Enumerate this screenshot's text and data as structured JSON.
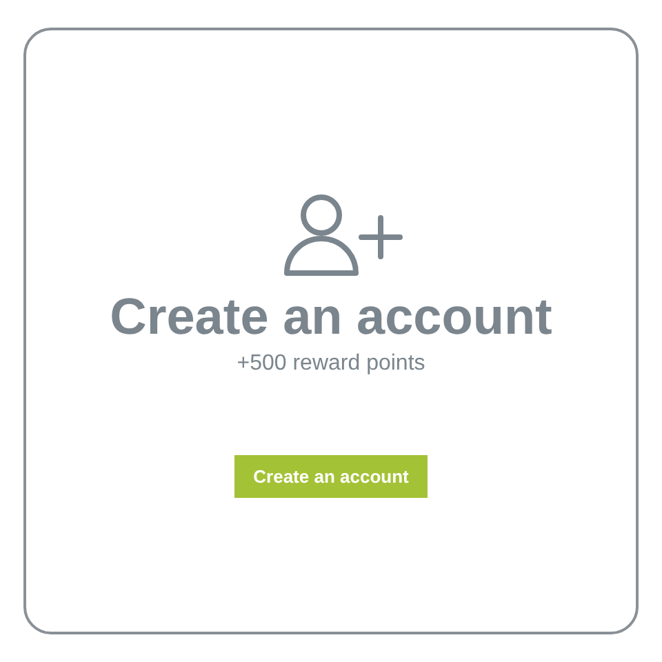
{
  "card": {
    "title": "Create an account",
    "subtitle": "+500 reward points",
    "button": "Create an account"
  }
}
